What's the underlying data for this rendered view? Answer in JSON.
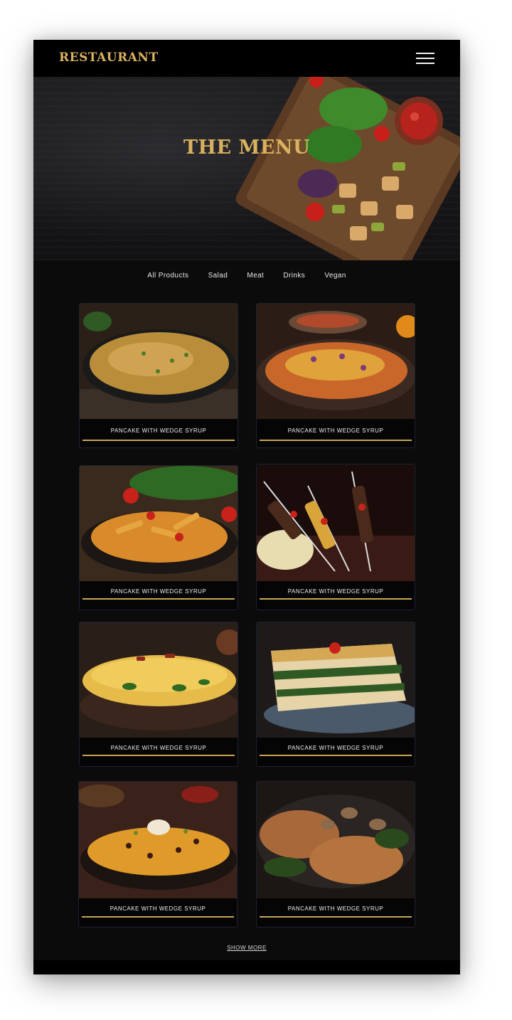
{
  "header": {
    "logo": "RESTAURANT",
    "menu_icon": "hamburger-menu-icon"
  },
  "hero": {
    "title": "THE MENU"
  },
  "filters": [
    "All Products",
    "Salad",
    "Meat",
    "Drinks",
    "Vegan"
  ],
  "products": [
    {
      "name": "PANCAKE WITH WEDGE SYRUP",
      "image": "baked-mac-and-cheese"
    },
    {
      "name": "PANCAKE WITH WEDGE SYRUP",
      "image": "enchiladas"
    },
    {
      "name": "PANCAKE WITH WEDGE SYRUP",
      "image": "penne-pasta"
    },
    {
      "name": "PANCAKE WITH WEDGE SYRUP",
      "image": "meat-skewers"
    },
    {
      "name": "PANCAKE WITH WEDGE SYRUP",
      "image": "omelette"
    },
    {
      "name": "PANCAKE WITH WEDGE SYRUP",
      "image": "lasagna"
    },
    {
      "name": "PANCAKE WITH WEDGE SYRUP",
      "image": "nachos"
    },
    {
      "name": "PANCAKE WITH WEDGE SYRUP",
      "image": "pork-chops-with-mushrooms"
    }
  ],
  "show_more": "SHOW MORE",
  "colors": {
    "accent_gold": "#d9b25f",
    "underline_gold": "#c9a552",
    "background": "#0b0b0b"
  }
}
